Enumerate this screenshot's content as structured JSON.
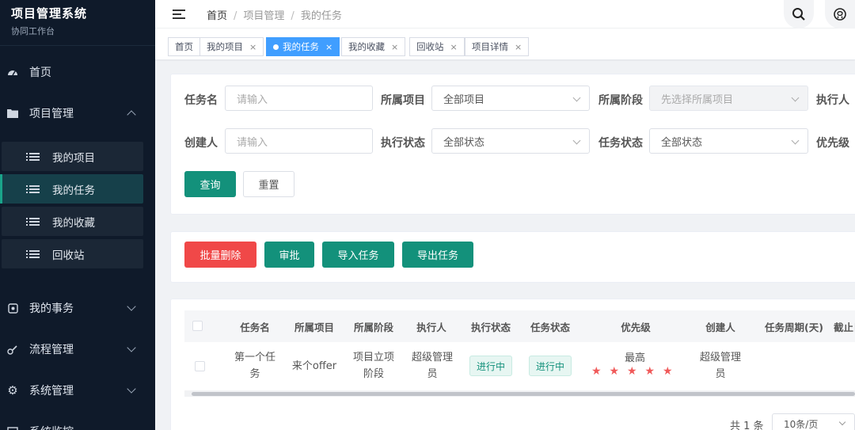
{
  "brand": {
    "title": "项目管理系统",
    "subtitle": "协同工作台"
  },
  "sidebar": {
    "items": [
      {
        "label": "首页",
        "icon": "dashboard-icon"
      },
      {
        "label": "项目管理",
        "icon": "folder-icon"
      },
      {
        "label": "我的事务",
        "icon": "task-icon"
      },
      {
        "label": "流程管理",
        "icon": "workflow-icon"
      },
      {
        "label": "系统管理",
        "icon": "gear-icon"
      },
      {
        "label": "系统监控",
        "icon": "monitor-icon"
      }
    ],
    "subitems": [
      {
        "label": "我的项目"
      },
      {
        "label": "我的任务",
        "active": true
      },
      {
        "label": "我的收藏"
      },
      {
        "label": "回收站"
      }
    ]
  },
  "header": {
    "breadcrumb": [
      "首页",
      "项目管理",
      "我的任务"
    ],
    "separator": "/"
  },
  "tags": [
    {
      "label": "首页",
      "closable": false
    },
    {
      "label": "我的项目",
      "closable": true
    },
    {
      "label": "我的任务",
      "closable": true,
      "active": true
    },
    {
      "label": "我的收藏",
      "closable": true
    },
    {
      "label": "回收站",
      "closable": true
    },
    {
      "label": "项目详情",
      "closable": true
    }
  ],
  "filters": {
    "task_name": {
      "label": "任务名",
      "placeholder": "请输入"
    },
    "project": {
      "label": "所属项目",
      "value": "全部项目"
    },
    "stage": {
      "label": "所属阶段",
      "placeholder": "先选择所属项目"
    },
    "executor": {
      "label": "执行人"
    },
    "creator": {
      "label": "创建人",
      "placeholder": "请输入"
    },
    "exec_status": {
      "label": "执行状态",
      "value": "全部状态"
    },
    "task_status": {
      "label": "任务状态",
      "value": "全部状态"
    },
    "priority": {
      "label": "优先级"
    },
    "query_label": "查询",
    "reset_label": "重置"
  },
  "actions": {
    "batch_delete": "批量删除",
    "approve": "审批",
    "import": "导入任务",
    "export": "导出任务"
  },
  "table": {
    "columns": [
      "任务名",
      "所属项目",
      "所属阶段",
      "执行人",
      "执行状态",
      "任务状态",
      "优先级",
      "创建人",
      "任务周期(天)",
      "截止日"
    ],
    "rows": [
      {
        "task_name": "第一个任务",
        "project": "来个offer",
        "stage": "项目立项阶段",
        "executor": "超级管理员",
        "exec_status": "进行中",
        "task_status": "进行中",
        "priority": "最高",
        "priority_stars": 5,
        "creator": "超级管理员",
        "period": "",
        "deadline": ""
      }
    ]
  },
  "pager": {
    "total": "共 1 条",
    "page_size": "10条/页"
  },
  "colors": {
    "accent": "#13917b",
    "danger": "#f04848",
    "tag_active": "#409eff",
    "star": "#f05a5a",
    "sidebar_bg": "#0f1a2a"
  }
}
